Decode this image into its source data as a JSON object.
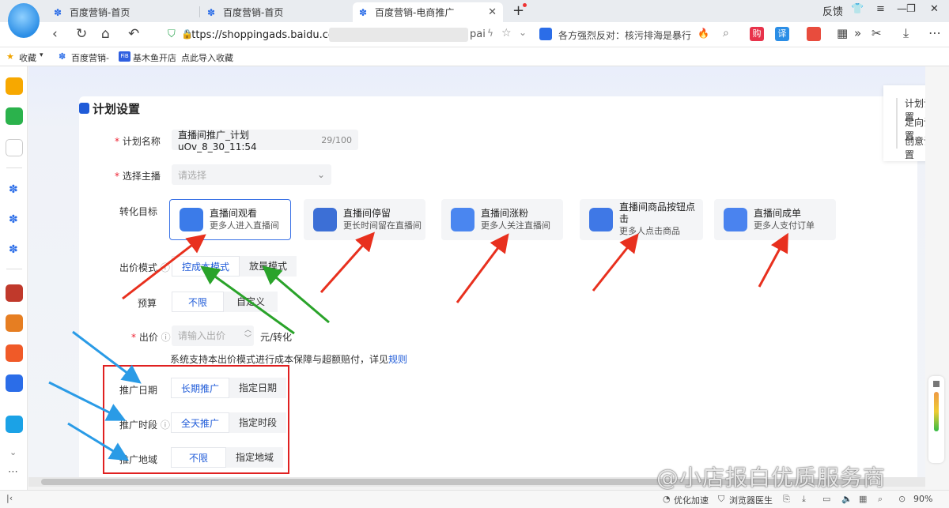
{
  "tabs": [
    {
      "label": "百度营销-首页"
    },
    {
      "label": "百度营销-首页"
    },
    {
      "label": "百度营销-电商推广"
    }
  ],
  "window": {
    "feedback": "反馈"
  },
  "address": {
    "url": "https://shoppingads.baidu.co",
    "url_tail": "pai",
    "news": "各方强烈反对：核污排海是暴行"
  },
  "bookmarks": {
    "fav": "收藏",
    "item1": "百度营销-",
    "item2": "基木鱼开店",
    "item3": "点此导入收藏"
  },
  "right_panel": {
    "items": [
      "计划设置",
      "定向设置",
      "创意设置"
    ]
  },
  "form": {
    "section_title": "计划设置",
    "plan_name_label": "计划名称",
    "plan_name_value": "直播间推广_计划uOv_8_30_11:54",
    "plan_name_count": "29/100",
    "anchor_label": "选择主播",
    "anchor_placeholder": "请选择",
    "goal_label": "转化目标",
    "goals": [
      {
        "title": "直播间观看",
        "sub": "更多人进入直播间",
        "color": "#3b7be9"
      },
      {
        "title": "直播间停留",
        "sub": "更长时间留在直播间",
        "color": "#3c6fd6"
      },
      {
        "title": "直播间涨粉",
        "sub": "更多人关注直播间",
        "color": "#4a86f0"
      },
      {
        "title": "直播间商品按钮点击",
        "sub": "更多人点击商品",
        "color": "#3f78e6"
      },
      {
        "title": "直播间成单",
        "sub": "更多人支付订单",
        "color": "#4a83ef"
      }
    ],
    "bid_mode_label": "出价模式",
    "bid_modes": [
      "控成本模式",
      "放量模式"
    ],
    "budget_label": "预算",
    "budget_options": [
      "不限",
      "自定义"
    ],
    "bid_label": "出价",
    "bid_placeholder": "请输入出价",
    "bid_unit": "元/转化",
    "notice": "系统支持本出价模式进行成本保障与超额赔付，详见",
    "notice_link": "规则",
    "date_label": "推广日期",
    "date_options": [
      "长期推广",
      "指定日期"
    ],
    "time_label": "推广时段",
    "time_options": [
      "全天推广",
      "指定时段"
    ],
    "region_label": "推广地域",
    "region_options": [
      "不限",
      "指定地域"
    ]
  },
  "status": {
    "speed": "优化加速",
    "doctor": "浏览器医生",
    "zoom": "90%"
  },
  "watermark": "@小店报白优质服务商"
}
